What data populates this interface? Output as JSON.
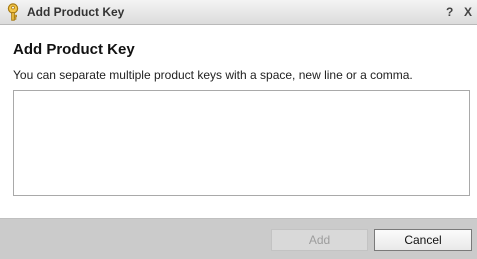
{
  "window": {
    "title": "Add Product Key",
    "help_label": "?",
    "close_label": "X",
    "icon": "key-icon",
    "icon_color": "#e8b53a"
  },
  "content": {
    "heading": "Add Product Key",
    "instructions": "You can separate multiple product keys with a space, new line or a comma.",
    "input_value": ""
  },
  "footer": {
    "add_label": "Add",
    "add_enabled": false,
    "cancel_label": "Cancel"
  }
}
